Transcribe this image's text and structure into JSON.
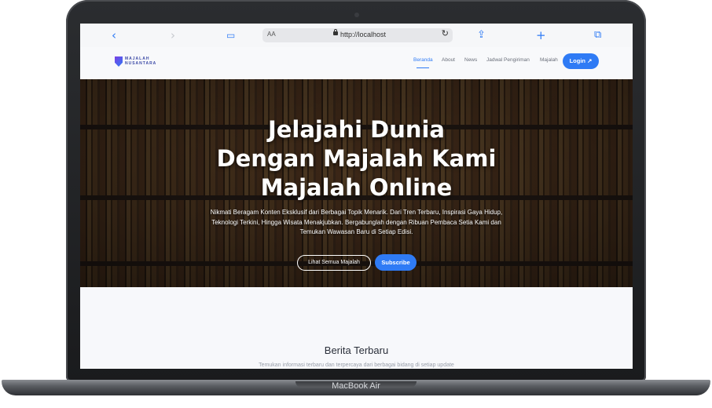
{
  "device": {
    "label": "MacBook Air"
  },
  "browser": {
    "text_size_label": "AA",
    "url": "http://localhost",
    "icons": [
      "chevron-left-icon",
      "chevron-right-icon",
      "book-icon",
      "lock-icon",
      "reload-icon",
      "share-icon",
      "plus-icon",
      "tabs-icon"
    ]
  },
  "site": {
    "logo_text": "MAJALAH NUSANTARA",
    "nav": [
      {
        "label": "Beranda",
        "active": true
      },
      {
        "label": "About"
      },
      {
        "label": "News"
      },
      {
        "label": "Jadwal Pengiriman"
      },
      {
        "label": "Majalah"
      }
    ],
    "login_label": "Login"
  },
  "hero": {
    "title_lines": [
      "Jelajahi Dunia",
      "Dengan Majalah Kami",
      "Majalah Online"
    ],
    "subtitle": "Nikmati Beragam Konten Eksklusif dari Berbagai Topik Menarik. Dari Tren Terbaru, Inspirasi Gaya Hidup, Teknologi Terkini, Hingga Wisata Menakjubkan. Bergabunglah dengan Ribuan Pembaca Setia Kami dan Temukan Wawasan Baru di Setiap Edisi.",
    "btn_all": "Lihat Semua Majalah",
    "btn_subscribe": "Subscribe"
  },
  "section": {
    "title": "Berita Terbaru",
    "subtitle": "Temukan informasi terbaru dan terpercaya dari berbagai bidang di setiap update"
  },
  "colors": {
    "accent": "#2f7bf5",
    "bezel": "#1f2023"
  }
}
